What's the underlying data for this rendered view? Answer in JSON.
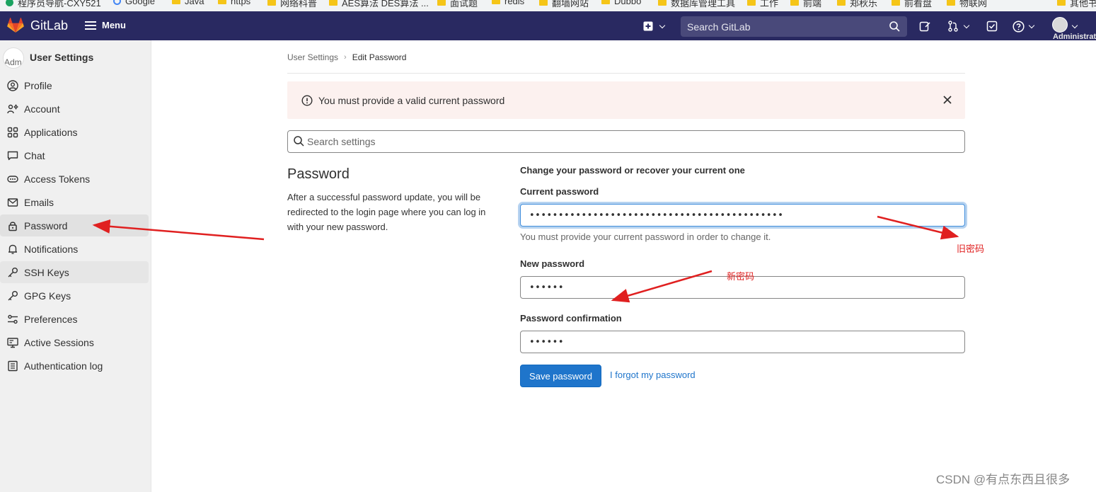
{
  "bookmarks": [
    {
      "label": "程序员导航-CXY521",
      "icon": "cxy-icon"
    },
    {
      "label": "Google",
      "icon": "google-icon"
    },
    {
      "label": "Java",
      "icon": "folder-icon"
    },
    {
      "label": "https",
      "icon": "folder-icon"
    },
    {
      "label": "网络科普",
      "icon": "folder-icon"
    },
    {
      "label": "AES算法 DES算法 ...",
      "icon": "folder-icon"
    },
    {
      "label": "面试题",
      "icon": "folder-icon"
    },
    {
      "label": "redis",
      "icon": "folder-icon"
    },
    {
      "label": "翻墙网站",
      "icon": "folder-icon"
    },
    {
      "label": "Dubbo",
      "icon": "folder-icon"
    },
    {
      "label": "数据库管理工具",
      "icon": "folder-icon"
    },
    {
      "label": "工作",
      "icon": "folder-icon"
    },
    {
      "label": "前端",
      "icon": "folder-icon"
    },
    {
      "label": "郑秋乐",
      "icon": "folder-icon"
    },
    {
      "label": "前看盘",
      "icon": "folder-icon"
    },
    {
      "label": "物联网",
      "icon": "folder-icon"
    },
    {
      "label": "其他书",
      "icon": "folder-icon"
    }
  ],
  "topbar": {
    "brand": "GitLab",
    "menu_label": "Menu",
    "search_placeholder": "Search GitLab",
    "user_label": "Administrator",
    "bg_color": "#292961"
  },
  "sidebar": {
    "title": "User Settings",
    "avatar_alt": "Adm",
    "items": [
      {
        "label": "Profile",
        "icon": "profile-icon"
      },
      {
        "label": "Account",
        "icon": "account-icon"
      },
      {
        "label": "Applications",
        "icon": "applications-icon"
      },
      {
        "label": "Chat",
        "icon": "chat-icon"
      },
      {
        "label": "Access Tokens",
        "icon": "token-icon"
      },
      {
        "label": "Emails",
        "icon": "mail-icon"
      },
      {
        "label": "Password",
        "icon": "lock-icon",
        "active": true
      },
      {
        "label": "Notifications",
        "icon": "bell-icon"
      },
      {
        "label": "SSH Keys",
        "icon": "key-icon"
      },
      {
        "label": "GPG Keys",
        "icon": "key-icon"
      },
      {
        "label": "Preferences",
        "icon": "preferences-icon"
      },
      {
        "label": "Active Sessions",
        "icon": "monitor-icon"
      },
      {
        "label": "Authentication log",
        "icon": "log-icon"
      }
    ]
  },
  "breadcrumb": {
    "parent": "User Settings",
    "current": "Edit Password"
  },
  "alert": {
    "message": "You must provide a valid current password",
    "bg_color": "#fcf1ef"
  },
  "settings_search": {
    "placeholder": "Search settings"
  },
  "section": {
    "title": "Password",
    "description": "After a successful password update, you will be redirected to the login page where you can log in with your new password."
  },
  "form": {
    "header": "Change your password or recover your current one",
    "current_label": "Current password",
    "current_value": "••••••••••••••••••••••••••••••••••••••••••••",
    "current_help": "You must provide your current password in order to change it.",
    "new_label": "New password",
    "new_value": "••••••",
    "confirm_label": "Password confirmation",
    "confirm_value": "••••••",
    "save_label": "Save password",
    "forgot_label": "I forgot my password",
    "primary_color": "#1f75cb"
  },
  "annotations": {
    "old_password": "旧密码",
    "new_password": "新密码",
    "color": "#e02020"
  },
  "watermark": "CSDN @有点东西且很多"
}
